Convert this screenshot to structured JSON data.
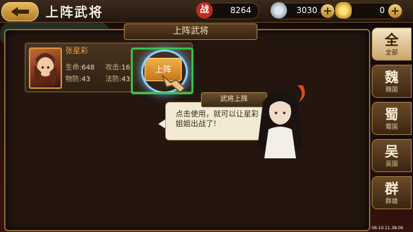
{
  "header": {
    "title": "上阵武将",
    "resources": {
      "zhan_label": "战",
      "power": "8264",
      "coins": "3030",
      "gold": "0"
    }
  },
  "panel": {
    "title": "上阵武将"
  },
  "hero": {
    "name": "张星彩",
    "stats": {
      "hp_label": "生命:",
      "hp": "648",
      "atk_label": "攻击:",
      "atk": "16",
      "pdef_label": "物防:",
      "pdef": "43",
      "mdef_label": "法防:",
      "mdef": "43"
    },
    "deploy_label": "上阵"
  },
  "tip": {
    "title": "武将上阵",
    "text": "点击使用，就可以让星彩姐姐出战了!"
  },
  "factions": [
    {
      "big": "全",
      "small": "全部"
    },
    {
      "big": "魏",
      "small": "魏国"
    },
    {
      "big": "蜀",
      "small": "蜀国"
    },
    {
      "big": "吴",
      "small": "吴国"
    },
    {
      "big": "群",
      "small": "群雄"
    }
  ],
  "timestamp": "06.10.11.38.06",
  "colors": {
    "highlight": "#35c24a",
    "accent": "#f0a23a"
  }
}
